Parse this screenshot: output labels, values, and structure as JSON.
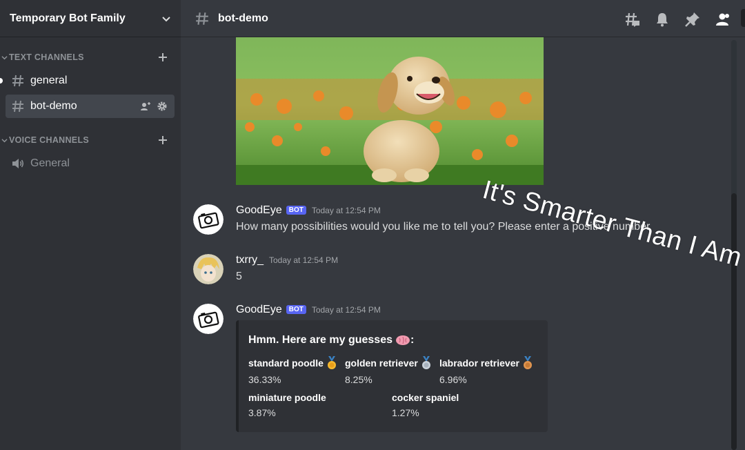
{
  "server": {
    "name": "Temporary Bot Family"
  },
  "sidebar": {
    "categories": [
      {
        "label": "TEXT CHANNELS"
      },
      {
        "label": "VOICE CHANNELS"
      }
    ],
    "text_channels": [
      {
        "label": "general"
      },
      {
        "label": "bot-demo"
      }
    ],
    "voice_channels": [
      {
        "label": "General"
      }
    ]
  },
  "header": {
    "channel": "bot-demo"
  },
  "messages": [
    {
      "author": "GoodEye",
      "tag": "BOT",
      "time": "Today at 12:54 PM",
      "text": "How many possibilities would you like me to tell you? Please enter a positive number"
    },
    {
      "author": "txrry_",
      "time": "Today at 12:54 PM",
      "text": "5"
    },
    {
      "author": "GoodEye",
      "tag": "BOT",
      "time": "Today at 12:54 PM"
    }
  ],
  "embed": {
    "title": "Hmm. Here are my guesses",
    "fields": [
      {
        "name": "standard poodle",
        "value": "36.33%",
        "medal": "gold"
      },
      {
        "name": "golden retriever",
        "value": "8.25%",
        "medal": "silver"
      },
      {
        "name": "labrador retriever",
        "value": "6.96%",
        "medal": "bronze"
      },
      {
        "name": "miniature poodle",
        "value": "3.87%"
      },
      {
        "name": "cocker spaniel",
        "value": "1.27%"
      }
    ]
  },
  "overlay": {
    "caption": "It's Smarter Than I Am"
  },
  "icons": {
    "server_menu": "chevron-down-icon",
    "threads": "threads-icon",
    "notifications": "bell-icon",
    "pinned": "pin-icon",
    "members": "members-icon"
  },
  "colors": {
    "accent": "#5865f2",
    "background": "#36393f",
    "sidebar": "#2f3136"
  }
}
